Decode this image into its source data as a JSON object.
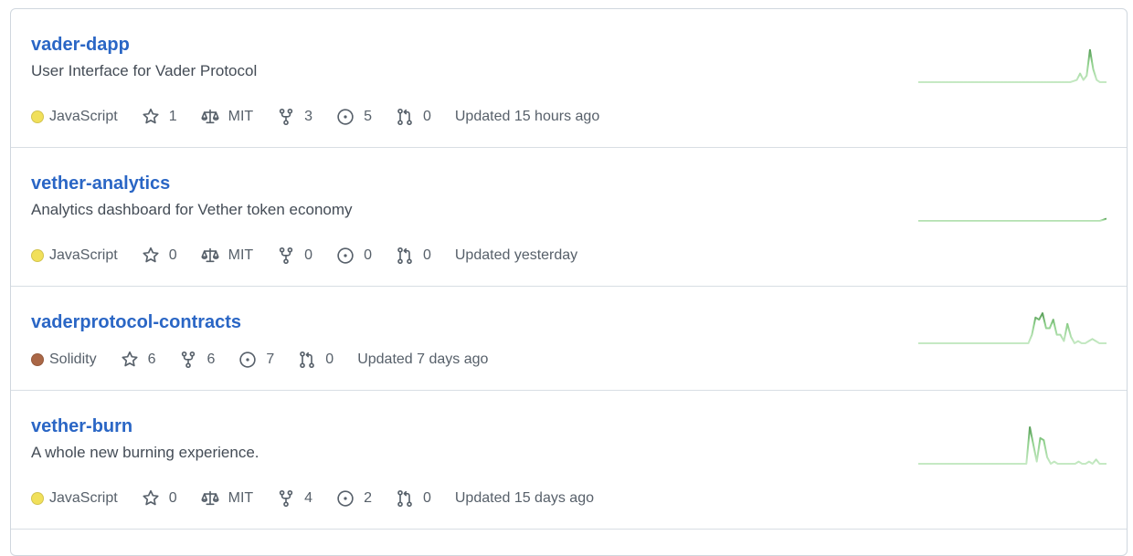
{
  "repos": [
    {
      "name": "vader-dapp",
      "description": "User Interface for Vader Protocol",
      "language": "JavaScript",
      "language_color": "#f1e05a",
      "stars": "1",
      "license": "MIT",
      "forks": "3",
      "issues": "5",
      "pulls": "0",
      "updated": "Updated 15 hours ago",
      "activity": [
        0,
        0,
        0,
        0,
        0,
        0,
        0,
        0,
        0,
        0,
        0,
        0,
        0,
        0,
        0,
        0,
        0,
        0,
        0,
        0,
        0,
        0,
        0,
        0,
        0,
        0,
        0,
        0,
        0,
        0,
        0,
        0,
        0,
        0,
        0,
        0,
        0,
        0,
        0,
        0,
        0,
        0,
        0,
        0,
        0,
        0,
        0,
        1,
        2,
        8,
        2,
        6,
        30,
        12,
        2,
        0,
        0,
        0
      ]
    },
    {
      "name": "vether-analytics",
      "description": "Analytics dashboard for Vether token economy",
      "language": "JavaScript",
      "language_color": "#f1e05a",
      "stars": "0",
      "license": "MIT",
      "forks": "0",
      "issues": "0",
      "pulls": "0",
      "updated": "Updated yesterday",
      "activity": [
        0,
        0,
        0,
        0,
        0,
        0,
        0,
        0,
        0,
        0,
        0,
        0,
        0,
        0,
        0,
        0,
        0,
        0,
        0,
        0,
        0,
        0,
        0,
        0,
        0,
        0,
        0,
        0,
        0,
        0,
        0,
        0,
        0,
        0,
        0,
        0,
        0,
        0,
        0,
        0,
        0,
        0,
        0,
        0,
        0,
        0,
        0,
        0,
        0,
        0,
        0,
        0,
        0,
        0,
        0,
        0,
        1,
        2
      ]
    },
    {
      "name": "vaderprotocol-contracts",
      "description": "",
      "language": "Solidity",
      "language_color": "#aa6746",
      "stars": "6",
      "license": "",
      "forks": "6",
      "issues": "7",
      "pulls": "0",
      "updated": "Updated 7 days ago",
      "activity": [
        0,
        0,
        0,
        0,
        0,
        0,
        0,
        0,
        0,
        0,
        0,
        0,
        0,
        0,
        0,
        0,
        0,
        0,
        0,
        0,
        0,
        0,
        0,
        0,
        0,
        0,
        0,
        0,
        0,
        0,
        0,
        0,
        8,
        24,
        22,
        28,
        14,
        14,
        22,
        8,
        8,
        2,
        18,
        6,
        0,
        2,
        0,
        0,
        2,
        4,
        2,
        0,
        0,
        0
      ]
    },
    {
      "name": "vether-burn",
      "description": "A whole new burning experience.",
      "language": "JavaScript",
      "language_color": "#f1e05a",
      "stars": "0",
      "license": "MIT",
      "forks": "4",
      "issues": "2",
      "pulls": "0",
      "updated": "Updated 15 days ago",
      "activity": [
        0,
        0,
        0,
        0,
        0,
        0,
        0,
        0,
        0,
        0,
        0,
        0,
        0,
        0,
        0,
        0,
        0,
        0,
        0,
        0,
        0,
        0,
        0,
        0,
        0,
        0,
        0,
        0,
        0,
        0,
        0,
        0,
        34,
        18,
        2,
        24,
        22,
        6,
        0,
        2,
        0,
        0,
        0,
        0,
        0,
        0,
        2,
        0,
        0,
        2,
        0,
        4,
        0,
        0,
        0
      ]
    }
  ]
}
